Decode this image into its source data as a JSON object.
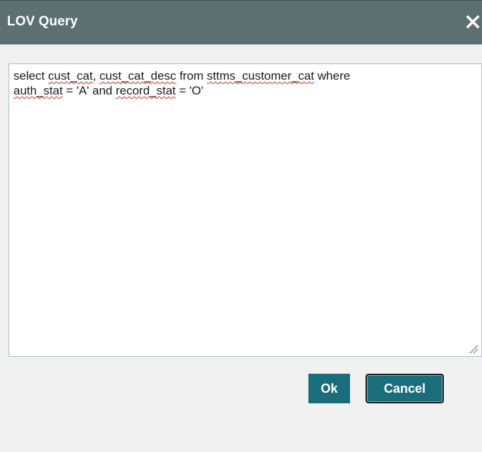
{
  "dialog": {
    "title": "LOV Query",
    "close_icon": "close-icon",
    "query": {
      "line1": [
        {
          "text": "select ",
          "spell": false
        },
        {
          "text": "cust_cat",
          "spell": true
        },
        {
          "text": ", ",
          "spell": false
        },
        {
          "text": "cust_cat_desc",
          "spell": true
        },
        {
          "text": " from ",
          "spell": false
        },
        {
          "text": "sttms_customer_cat",
          "spell": true
        },
        {
          "text": " where",
          "spell": false
        }
      ],
      "line2": [
        {
          "text": "auth_stat",
          "spell": true
        },
        {
          "text": " = 'A' and ",
          "spell": false
        },
        {
          "text": "record_stat",
          "spell": true
        },
        {
          "text": " = 'O'",
          "spell": false
        }
      ]
    },
    "buttons": {
      "ok_label": "Ok",
      "cancel_label": "Cancel"
    }
  },
  "colors": {
    "titlebar": "#5c7072",
    "button": "#1a6e7c",
    "background": "#f1f1f1"
  }
}
